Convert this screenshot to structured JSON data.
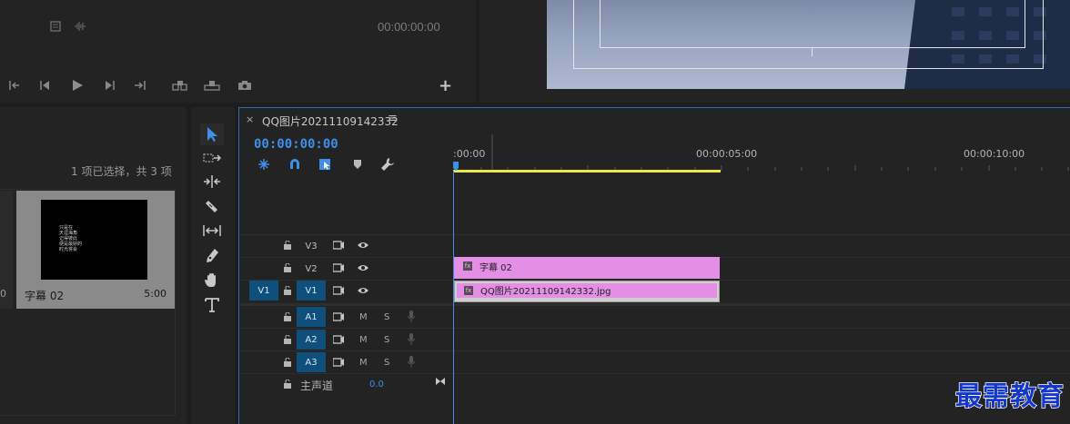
{
  "source_monitor": {
    "timecode": "00:00:00:00",
    "icons": [
      "film-icon",
      "waveform-icon",
      "mark-in-icon",
      "step-back-icon",
      "play-icon",
      "step-forward-icon",
      "mark-out-icon",
      "insert-icon",
      "overwrite-icon",
      "camera-icon",
      "add-icon"
    ],
    "add_label": "+"
  },
  "project_panel": {
    "status": "1 项已选择，共 3 项",
    "partial_left_duration": "0",
    "item": {
      "name": "字幕 02",
      "duration": "5:00",
      "thumb_lines": [
        "只是在",
        "天涯海角",
        "记得彼此",
        "便是最好的",
        "时光将会"
      ]
    }
  },
  "tools": [
    "selection-tool",
    "track-select-tool",
    "ripple-edit-tool",
    "razor-tool",
    "slip-tool",
    "pen-tool",
    "hand-tool",
    "type-tool"
  ],
  "timeline": {
    "close_label": "×",
    "sequence_name": "QQ图片20211109142332",
    "menu_label": "≡",
    "timecode": "00:00:00:00",
    "ruler": {
      "labels": [
        ":00:00",
        "00:00:05:00",
        "00:00:10:00"
      ]
    },
    "tracks": {
      "v3": {
        "label": "V3"
      },
      "v2": {
        "label": "V2"
      },
      "v1": {
        "label": "V1",
        "source_label": "V1"
      },
      "a1": {
        "label": "A1",
        "m": "M",
        "s": "S"
      },
      "a2": {
        "label": "A2",
        "m": "M",
        "s": "S"
      },
      "a3": {
        "label": "A3",
        "m": "M",
        "s": "S"
      },
      "master": {
        "label": "主声道",
        "value": "0.0"
      }
    },
    "clips": {
      "v2": {
        "name": "字幕 02",
        "fx": "fx"
      },
      "v1": {
        "name": "QQ图片20211109142332.jpg",
        "fx": "fx"
      }
    }
  },
  "watermark": "最需教育",
  "colors": {
    "accent_blue": "#3d8fe8",
    "clip_pink": "#e48ee6",
    "track_blue": "#0e4f7c",
    "work_area": "#e8e84a"
  }
}
